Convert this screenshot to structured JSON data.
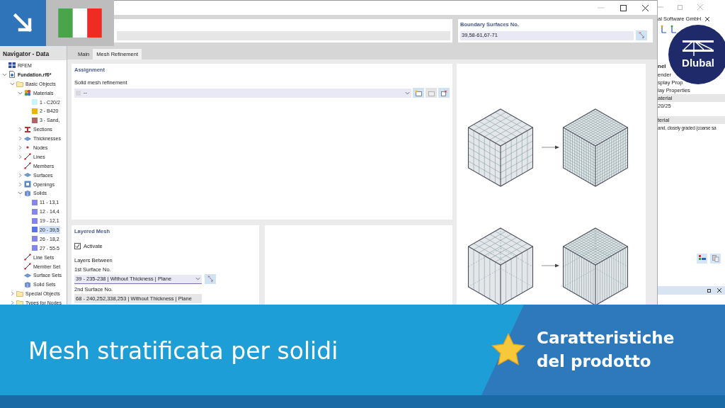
{
  "navigator": {
    "title": "Navigator - Data",
    "tree": [
      {
        "label": "RFEM",
        "kind": "app",
        "selected": false
      },
      {
        "label": "Fundation.rf6*",
        "kind": "file",
        "expanded": true,
        "selected": false,
        "children": [
          {
            "label": "Basic Objects",
            "kind": "folder",
            "expanded": true,
            "selected": false,
            "children": [
              {
                "label": "Materials",
                "kind": "materials",
                "expanded": true,
                "selected": false,
                "children": [
                  {
                    "label": "1 - C20/2",
                    "kind": "swatch",
                    "color": "#c8f4f6",
                    "selected": false
                  },
                  {
                    "label": "2 - B420",
                    "kind": "swatch",
                    "color": "#f0b400",
                    "selected": false
                  },
                  {
                    "label": "3 - Sand,",
                    "kind": "swatch",
                    "color": "#b06464",
                    "selected": false
                  }
                ]
              },
              {
                "label": "Sections",
                "kind": "section",
                "expanded": false,
                "selected": false
              },
              {
                "label": "Thicknesses",
                "kind": "plate",
                "expanded": false,
                "selected": false
              },
              {
                "label": "Nodes",
                "kind": "node",
                "expanded": false,
                "selected": false
              },
              {
                "label": "Lines",
                "kind": "line",
                "expanded": false,
                "selected": false
              },
              {
                "label": "Members",
                "kind": "line",
                "selected": false
              },
              {
                "label": "Surfaces",
                "kind": "plate",
                "expanded": false,
                "selected": false
              },
              {
                "label": "Openings",
                "kind": "opening",
                "expanded": false,
                "selected": false
              },
              {
                "label": "Solids",
                "kind": "solid",
                "expanded": true,
                "selected": false,
                "children": [
                  {
                    "label": "11 - 13,1",
                    "kind": "swatch",
                    "color": "#8585f2",
                    "selected": false
                  },
                  {
                    "label": "12 - 14,4",
                    "kind": "swatch",
                    "color": "#8585f2",
                    "selected": false
                  },
                  {
                    "label": "19 - 12,1",
                    "kind": "swatch",
                    "color": "#8585f2",
                    "selected": false
                  },
                  {
                    "label": "20 - 39,5",
                    "kind": "swatch",
                    "color": "#5a74e8",
                    "selected": true
                  },
                  {
                    "label": "26 - 18,2",
                    "kind": "swatch",
                    "color": "#8585f2",
                    "selected": false
                  },
                  {
                    "label": "27 - 55-5",
                    "kind": "swatch",
                    "color": "#8585f2",
                    "selected": false
                  }
                ]
              },
              {
                "label": "Line Sets",
                "kind": "line",
                "selected": false
              },
              {
                "label": "Member Set",
                "kind": "line",
                "selected": false
              },
              {
                "label": "Surface Sets",
                "kind": "plate",
                "selected": false
              },
              {
                "label": "Solid Sets",
                "kind": "solid",
                "selected": false
              }
            ]
          },
          {
            "label": "Special Objects",
            "kind": "folder",
            "expanded": false,
            "selected": false
          },
          {
            "label": "Types for Nodes",
            "kind": "folder",
            "expanded": false,
            "selected": false
          }
        ]
      }
    ]
  },
  "dialog": {
    "boundary": {
      "label": "Boundary Surfaces No.",
      "value": "39,58-61,67-71"
    },
    "tabs": [
      {
        "label": "Main",
        "selected": false
      },
      {
        "label": "Mesh Refinement",
        "selected": true
      }
    ],
    "assignment": {
      "heading": "Assignment",
      "label": "Solid mesh refinement",
      "value": "--"
    },
    "layered_mesh": {
      "heading": "Layered Mesh",
      "activate": {
        "label": "Activate",
        "checked": true
      },
      "layers_label": "Layers Between",
      "first": {
        "label": "1st Surface No.",
        "value": "39 - 235-238 | Without Thickness | Plane"
      },
      "second": {
        "label": "2nd Surface No.",
        "value": "68 - 240,252,338,253 | Without Thickness | Plane"
      }
    }
  },
  "side_panel": {
    "company": "al Software GmbH",
    "header": "nel",
    "rows": [
      "ender",
      "splay Prop",
      "lay Properties"
    ],
    "section_1": "aterial",
    "value_1": "20/25",
    "section_2": "terial",
    "value_2": "and, closely graded (coarse sa"
  },
  "logo": {
    "text": "Dlubal"
  },
  "banner": {
    "title": "Mesh stratificata per solidi",
    "subtitle": "Caratteristiche del prodotto"
  }
}
